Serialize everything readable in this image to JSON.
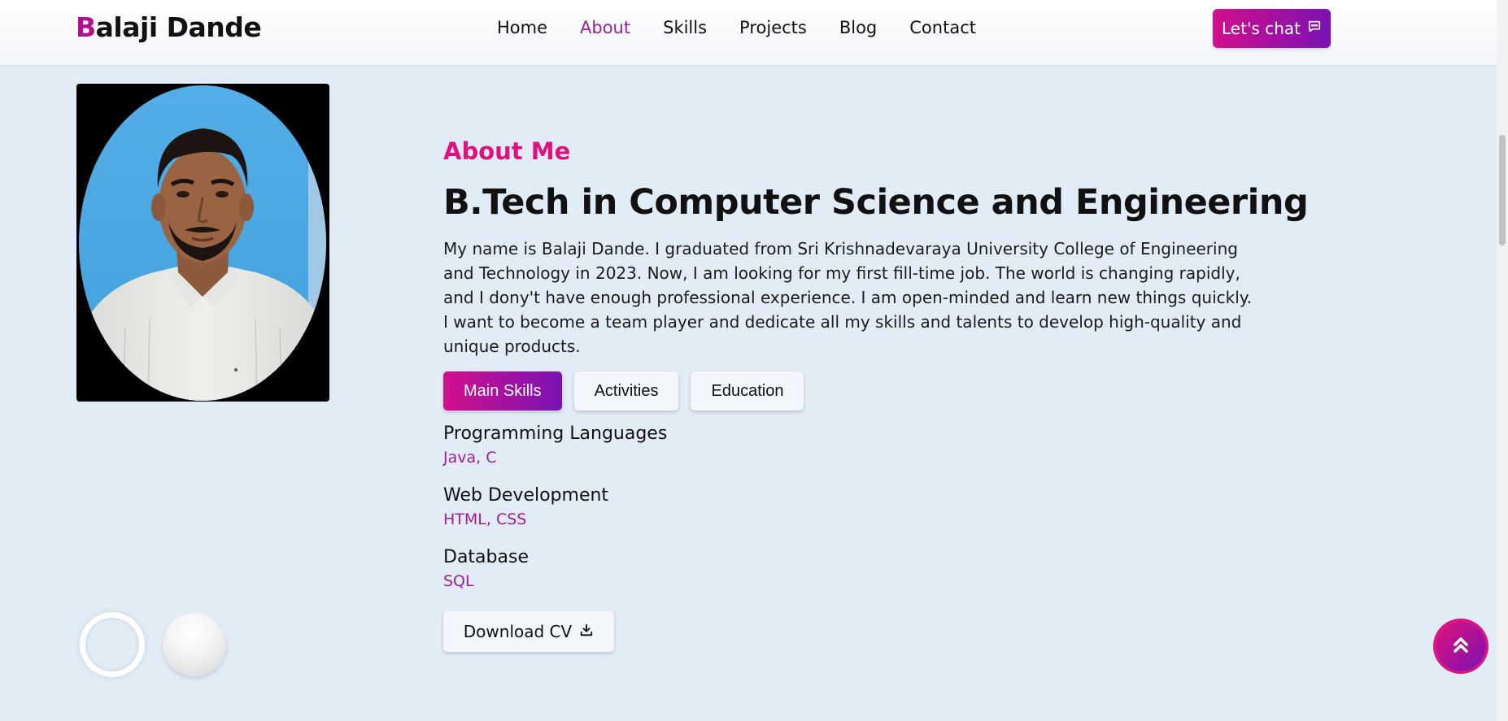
{
  "brand": {
    "first_letter": "B",
    "rest": "alaji Dande"
  },
  "nav": {
    "items": [
      {
        "label": "Home"
      },
      {
        "label": "About",
        "active": true
      },
      {
        "label": "Skills"
      },
      {
        "label": "Projects"
      },
      {
        "label": "Blog"
      },
      {
        "label": "Contact"
      }
    ]
  },
  "chat_button": {
    "label": "Let's chat",
    "icon": "chat-icon"
  },
  "about": {
    "section_label": "About Me",
    "headline": "B.Tech in Computer Science and Engineering",
    "bio": "My name is Balaji Dande. I graduated from Sri Krishnadevaraya University College of Engineering and Technology in 2023. Now, I am looking for my first fill-time job. The world is changing rapidly, and I dony't have enough professional experience. I am open-minded and learn new things quickly. I want to become a team player and dedicate all my skills and talents to develop high-quality and unique products."
  },
  "tabs": [
    {
      "label": "Main Skills",
      "active": true
    },
    {
      "label": "Activities"
    },
    {
      "label": "Education"
    }
  ],
  "skills": [
    {
      "title": "Programming Languages",
      "value": "Java, C"
    },
    {
      "title": "Web Development",
      "value": "HTML, CSS"
    },
    {
      "title": "Database",
      "value": "SQL"
    }
  ],
  "download": {
    "label": "Download CV",
    "icon": "download-icon"
  },
  "back_to_top": {
    "icon": "double-chevron-up-icon"
  },
  "colors": {
    "accent_pink": "#e0117b",
    "accent_purple": "#7a12b4",
    "link_purple": "#9a1f9e",
    "background": "#e2ecf6"
  }
}
